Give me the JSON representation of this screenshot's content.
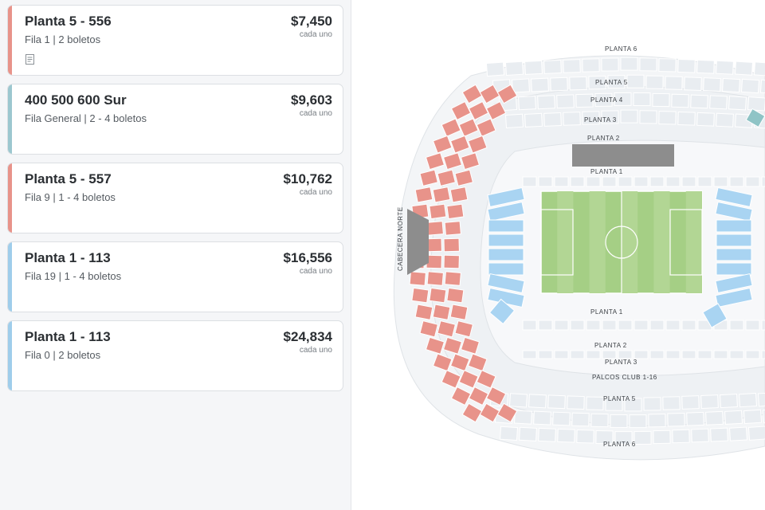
{
  "listings": [
    {
      "title": "Planta 5 - 556",
      "details": "Fila 1 | 2 boletos",
      "price": "$7,450",
      "unit": "cada uno",
      "accent": "#e8938a",
      "has_note": true
    },
    {
      "title": "400 500 600 Sur",
      "details": "Fila General | 2 - 4 boletos",
      "price": "$9,603",
      "unit": "cada uno",
      "accent": "#9cc7cf",
      "has_note": false
    },
    {
      "title": "Planta 5 - 557",
      "details": "Fila 9 | 1 - 4 boletos",
      "price": "$10,762",
      "unit": "cada uno",
      "accent": "#e8938a",
      "has_note": false
    },
    {
      "title": "Planta 1 - 113",
      "details": "Fila 19 | 1 - 4 boletos",
      "price": "$16,556",
      "unit": "cada uno",
      "accent": "#9fcdeb",
      "has_note": false
    },
    {
      "title": "Planta 1 - 113",
      "details": "Fila 0 | 2 boletos",
      "price": "$24,834",
      "unit": "cada uno",
      "accent": "#9fcdeb",
      "has_note": false
    }
  ],
  "map": {
    "labels": {
      "planta6_top": "PLANTA 6",
      "planta5_top": "PLANTA 5",
      "planta4": "PLANTA 4",
      "planta3_top": "PLANTA 3",
      "planta2_top": "PLANTA 2",
      "planta1_top": "PLANTA 1",
      "planta1_bottom": "PLANTA 1",
      "planta2_bottom": "PLANTA 2",
      "planta3_bottom": "PLANTA 3",
      "palcos": "PALCOS CLUB 1-16",
      "planta5_bottom": "PLANTA 5",
      "planta6_bottom": "PLANTA 6",
      "cabecera": "CABECERA NORTE"
    },
    "colors": {
      "available_red": "#e8938a",
      "available_blue": "#a9d4f2",
      "available_teal": "#8fc4c6",
      "unavailable": "#e9edf1",
      "stage": "#8a8a8a",
      "pitch": "#9cc97a"
    }
  }
}
